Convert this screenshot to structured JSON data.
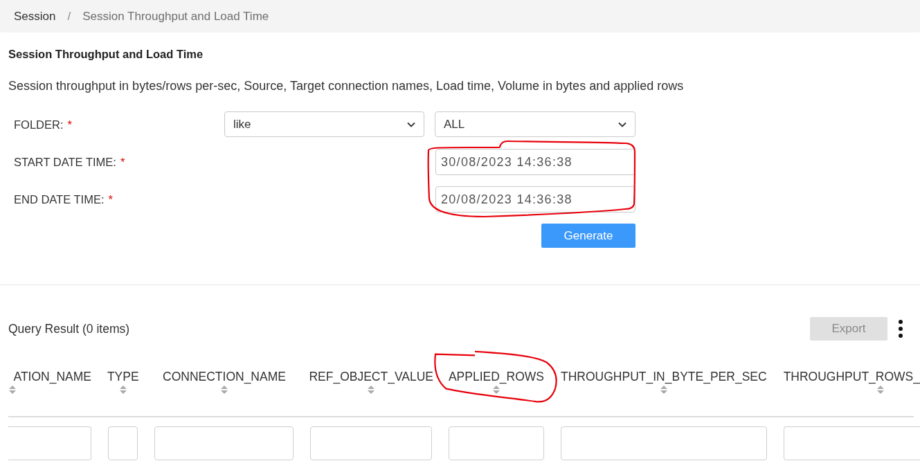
{
  "breadcrumb": {
    "separator": "/",
    "items": [
      {
        "label": "Session",
        "current": false
      },
      {
        "label": "Session Throughput and Load Time",
        "current": true
      }
    ]
  },
  "page": {
    "title": "Session Throughput and Load Time",
    "description": "Session throughput in bytes/rows per-sec, Source, Target connection names, Load time, Volume in bytes and applied rows"
  },
  "form": {
    "fields": [
      {
        "kind": "select-pair",
        "label": "FOLDER:",
        "required_mark": "*",
        "operator": "like",
        "value": "ALL"
      },
      {
        "kind": "datetime",
        "label": "START DATE TIME:",
        "required_mark": "*",
        "value": "30/08/2023 14:36:38"
      },
      {
        "kind": "datetime",
        "label": "END DATE TIME:",
        "required_mark": "*",
        "value": "20/08/2023 14:36:38"
      }
    ],
    "dates_circled": true,
    "generate_button": "Generate"
  },
  "results": {
    "title": "Query Result (0 items)",
    "export_button": {
      "label": "Export",
      "disabled": true
    },
    "columns": [
      {
        "label": "ATION_NAME",
        "circled": false
      },
      {
        "label": "TYPE",
        "circled": false
      },
      {
        "label": "CONNECTION_NAME",
        "circled": false
      },
      {
        "label": "REF_OBJECT_VALUE",
        "circled": false
      },
      {
        "label": "APPLIED_ROWS",
        "circled": true
      },
      {
        "label": "THROUGHPUT_IN_BYTE_PER_SEC",
        "circled": false
      },
      {
        "label": "THROUGHPUT_ROWS_",
        "circled": false
      }
    ]
  }
}
